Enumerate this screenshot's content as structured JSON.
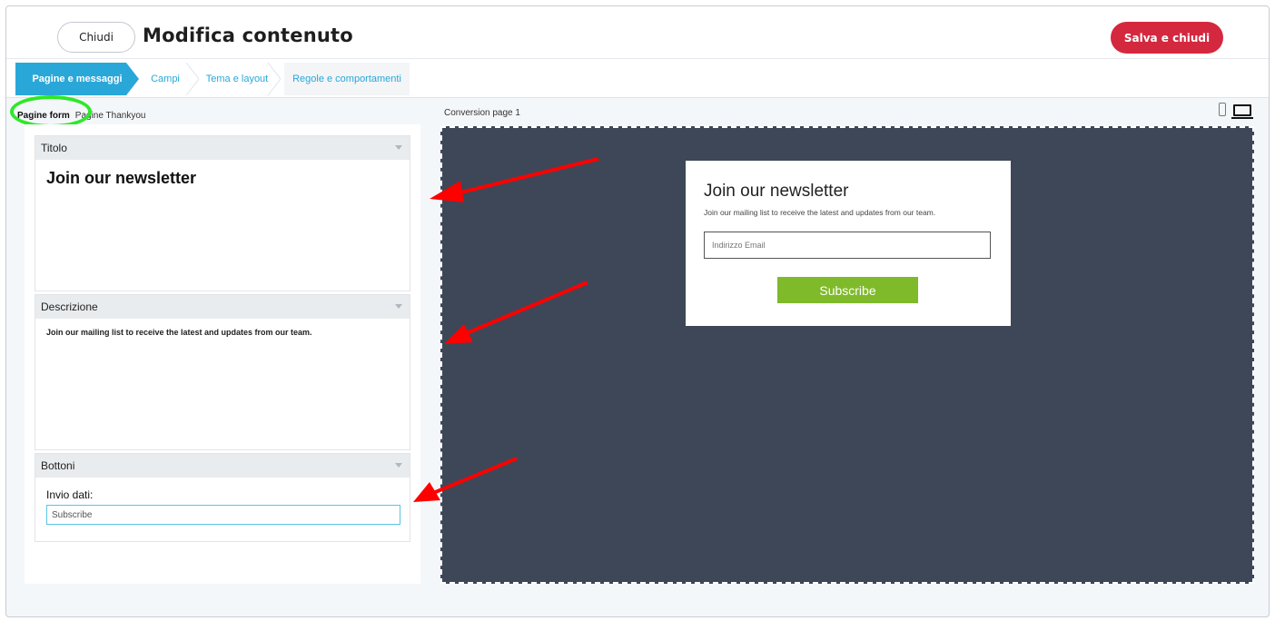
{
  "header": {
    "close_label": "Chiudi",
    "title": "Modifica contenuto",
    "save_label": "Salva e chiudi"
  },
  "steps": [
    {
      "label": "Pagine e messaggi",
      "active": true
    },
    {
      "label": "Campi",
      "active": false
    },
    {
      "label": "Tema e layout",
      "active": false
    },
    {
      "label": "Regole e comportamenti",
      "active": false
    }
  ],
  "subtabs": [
    {
      "label": "Pagine form",
      "active": true
    },
    {
      "label": "Pagine Thankyou",
      "active": false
    }
  ],
  "sections": {
    "titolo": {
      "header": "Titolo",
      "content": "Join our newsletter"
    },
    "descrizione": {
      "header": "Descrizione",
      "content": "Join our mailing list to receive the latest and updates from our team."
    },
    "bottoni": {
      "header": "Bottoni",
      "field_label": "Invio dati:",
      "field_value": "Subscribe"
    }
  },
  "preview": {
    "label": "Conversion page 1",
    "card": {
      "title": "Join our newsletter",
      "subtitle": "Join our mailing list to receive the latest and updates from our team.",
      "email_placeholder": "Indirizzo Email",
      "button_label": "Subscribe"
    }
  },
  "colors": {
    "accent": "#2aa7d9",
    "save": "#d4283f",
    "preview_bg": "#3d4758",
    "subscribe": "#7fba2b",
    "highlight": "#2ee82a",
    "annotation": "#ff0000"
  },
  "icons": {
    "mobile": "mobile-device-icon",
    "desktop": "desktop-monitor-icon",
    "caret": "caret-down-icon"
  }
}
